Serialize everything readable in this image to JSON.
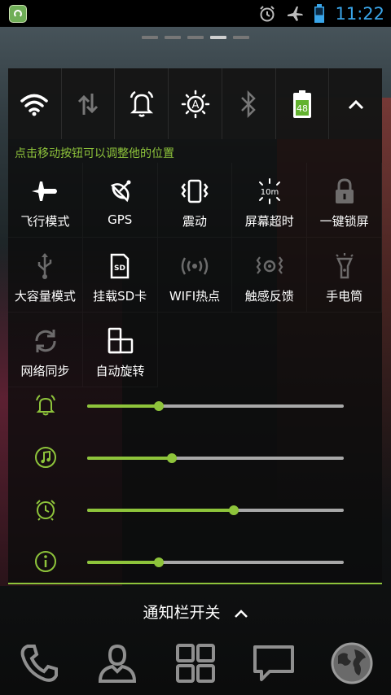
{
  "status_bar": {
    "time": "11:22",
    "icons": [
      "app-notification-icon",
      "alarm-icon",
      "airplane-mode-icon",
      "battery-icon"
    ]
  },
  "home_pages": {
    "count": 5,
    "active_index": 3
  },
  "panel": {
    "quick_toggles": [
      {
        "name": "wifi-icon",
        "active": true
      },
      {
        "name": "data-sync-arrows-icon",
        "active": false
      },
      {
        "name": "ring-alarm-bell-icon",
        "active": true
      },
      {
        "name": "auto-brightness-icon",
        "active": true
      },
      {
        "name": "bluetooth-icon",
        "active": false
      },
      {
        "name": "battery-icon",
        "active": true,
        "level": "48"
      },
      {
        "name": "collapse-chevron-up-icon",
        "active": true
      }
    ],
    "hint": "点击移动按钮可以调整他的位置",
    "tiles": [
      {
        "label": "飞行模式",
        "icon": "airplane-icon",
        "active": true
      },
      {
        "label": "GPS",
        "icon": "gps-satellite-icon",
        "active": true
      },
      {
        "label": "震动",
        "icon": "vibrate-icon",
        "active": true
      },
      {
        "label": "屏幕超时",
        "icon": "screen-timeout-icon",
        "active": true,
        "icon_text": "10m"
      },
      {
        "label": "一键锁屏",
        "icon": "lock-icon",
        "active": false
      },
      {
        "label": "大容量模式",
        "icon": "usb-icon",
        "active": false
      },
      {
        "label": "挂载SD卡",
        "icon": "sd-card-icon",
        "active": true,
        "icon_text": "SD"
      },
      {
        "label": "WIFI热点",
        "icon": "wifi-hotspot-icon",
        "active": false
      },
      {
        "label": "触感反馈",
        "icon": "haptic-feedback-icon",
        "active": false
      },
      {
        "label": "手电筒",
        "icon": "flashlight-icon",
        "active": false
      },
      {
        "label": "网络同步",
        "icon": "network-sync-icon",
        "active": false
      },
      {
        "label": "自动旋转",
        "icon": "auto-rotate-icon",
        "active": true
      }
    ],
    "sliders": [
      {
        "name": "alarm-volume",
        "icon": "alarm-bell-icon",
        "level": 0.28
      },
      {
        "name": "music-volume",
        "icon": "music-note-icon",
        "level": 0.33
      },
      {
        "name": "alarm-clock-volume",
        "icon": "alarm-clock-icon",
        "level": 0.57
      },
      {
        "name": "notification-volume",
        "icon": "info-icon",
        "level": 0.28
      }
    ],
    "accent": "#8ec43b"
  },
  "notification_toggle": {
    "label": "通知栏开关"
  },
  "dock": [
    "phone-icon",
    "contacts-icon",
    "app-drawer-grid-icon",
    "messaging-icon",
    "browser-globe-icon"
  ],
  "colors": {
    "accent_green": "#8ec43b",
    "clock_blue": "#3aa6ea"
  }
}
